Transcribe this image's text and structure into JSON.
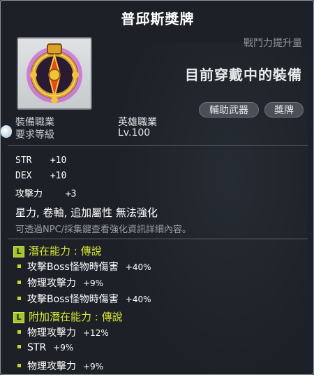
{
  "title": "普邱斯獎牌",
  "cp_label": "戰鬥力提升量",
  "equipped_label": "目前穿戴中的裝備",
  "tags": {
    "secondary": "輔助武器",
    "medal": "獎牌"
  },
  "requirements": {
    "job_label": "裝備職業",
    "job_value": "英雄職業",
    "level_label": "要求等級",
    "level_value": "Lv.100"
  },
  "stats": [
    {
      "name": "STR",
      "value": "+10"
    },
    {
      "name": "DEX",
      "value": "+10"
    },
    {
      "name": "攻擊力",
      "value": "+3"
    }
  ],
  "notes": "星力, 卷軸, 追加屬性 無法強化",
  "hint": "可透過NPC/採集鍵查看強化資訊詳細內容。",
  "potential": {
    "badge": "L",
    "header": "潛在能力 : 傳說",
    "lines": [
      {
        "text": "攻擊Boss怪物時傷害",
        "value": "+40%"
      },
      {
        "text": "物理攻擊力",
        "value": "+9%"
      },
      {
        "text": "攻擊Boss怪物時傷害",
        "value": "+40%"
      }
    ]
  },
  "bonus_potential": {
    "badge": "L",
    "header": "附加潛在能力 : 傳說",
    "lines": [
      {
        "text": "物理攻擊力",
        "value": "+12%"
      },
      {
        "text": "STR",
        "value": "+9%"
      },
      {
        "text": "物理攻擊力",
        "value": "+9%"
      }
    ]
  },
  "colors": {
    "legendary": "#d7e632",
    "badge": "#a4c42a",
    "text": "#ffffff",
    "muted": "#9aa0a6"
  }
}
